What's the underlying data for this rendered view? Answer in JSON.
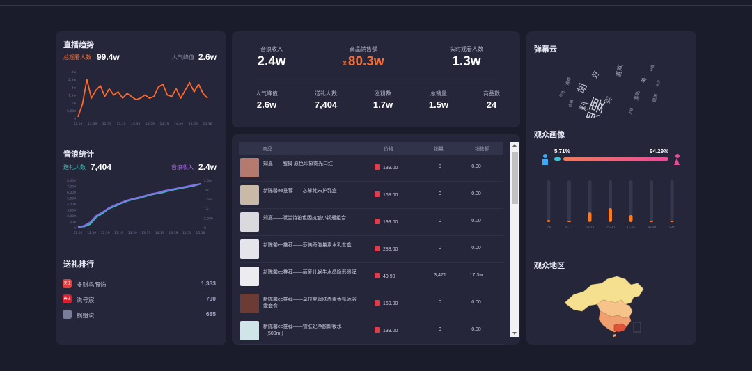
{
  "trend": {
    "title": "直播趋势",
    "total_label": "总观看人数",
    "total_value": "99.4w",
    "peak_label": "人气峰值",
    "peak_value": "2.6w"
  },
  "gift_stats": {
    "title": "音浪统计",
    "gift_people_label": "送礼人数",
    "gift_people_value": "7,404",
    "income_label": "音浪收入",
    "income_value": "2.4w"
  },
  "ranking": {
    "title": "送礼排行",
    "items": [
      {
        "badge": "美注",
        "name": "多财鸟服饰",
        "value": "1,383",
        "color": "#e53b3b"
      },
      {
        "badge": "美注",
        "name": "说号宸",
        "value": "790",
        "color": "#e11b2b"
      },
      {
        "badge": "",
        "name": "锅姐说",
        "value": "685",
        "color": "#7a7d9a"
      }
    ]
  },
  "summary": {
    "top": [
      {
        "label": "音浪收入",
        "value": "2.4w"
      },
      {
        "label": "商品销售额",
        "value": "80.3w",
        "prefix": "¥"
      },
      {
        "label": "实时观看人数",
        "value": "1.3w"
      }
    ],
    "bottom": [
      {
        "label": "人气峰值",
        "value": "2.6w"
      },
      {
        "label": "送礼人数",
        "value": "7,404"
      },
      {
        "label": "涨粉数",
        "value": "1.7w"
      },
      {
        "label": "总销量",
        "value": "1.5w"
      },
      {
        "label": "商品数",
        "value": "24"
      }
    ]
  },
  "table": {
    "headers": [
      "商品",
      "价格",
      "销量",
      "销售额"
    ],
    "rows": [
      {
        "name": "知嘉——醒摸 原色印象雾光口红",
        "price": "139.00",
        "qty": "0",
        "amount": "0.00",
        "thumb": "#b57a6e"
      },
      {
        "name": "新陈馨ee推荐——芯掌梵未护乳盒",
        "price": "168.00",
        "qty": "0",
        "amount": "0.00",
        "thumb": "#c9b9a6"
      },
      {
        "name": "知嘉——賦兰诗铂色因抗皱小钢瓶组合",
        "price": "199.00",
        "qty": "0",
        "amount": "0.00",
        "thumb": "#d9d9de"
      },
      {
        "name": "新陈馨ee推荐——莎美奇能量素水乳套盒",
        "price": "288.00",
        "qty": "0",
        "amount": "0.00",
        "thumb": "#e4e4ea"
      },
      {
        "name": "新陈馨ee推荐——丽爱儿蜗牛水晶隐形眼膜",
        "price": "49.90",
        "qty": "3,471",
        "amount": "17.3w",
        "thumb": "#ececf0"
      },
      {
        "name": "新陈馨ee推荐——莫拉克润肤赤素香氛沐浴露套盒",
        "price": "169.00",
        "qty": "0",
        "amount": "0.00",
        "thumb": "#6b3b34"
      },
      {
        "name": "新陈馨ee推荐——雪肤妃净颜卸妆水（500ml）",
        "price": "139.00",
        "qty": "0",
        "amount": "0.00",
        "thumb": "#cfe5e8"
      }
    ]
  },
  "danmu": {
    "title": "弹幕云"
  },
  "portrait": {
    "title": "观众画像",
    "male_pct": "5.71%",
    "female_pct": "94.29%"
  },
  "region": {
    "title": "观众地区"
  },
  "colors": {
    "accent_orange": "#ff6a2b",
    "accent_blue": "#3fa9f5",
    "accent_pink": "#e94b9a",
    "purple": "#8a6cf0"
  },
  "chart_data": [
    {
      "type": "line",
      "name": "trend",
      "x": [
        "12:02",
        "12:39",
        "12:59",
        "13:19",
        "13:39",
        "13:59",
        "14:19",
        "14:39",
        "14:59",
        "15:16"
      ],
      "ytick_labels": [
        "0",
        "5,000",
        "1w",
        "1.5w",
        "2w",
        "2.5w",
        "3w"
      ],
      "ylim": [
        0,
        30000
      ],
      "series": [
        {
          "values": [
            1000,
            9000,
            25000,
            13000,
            18000,
            21000,
            14000,
            19000,
            15000,
            17000,
            13000,
            16000,
            14000,
            12000,
            13000,
            15000,
            13000,
            14000,
            20000,
            22000,
            15000,
            14000,
            19000,
            13000,
            18000,
            23000,
            17000,
            22000,
            16000,
            13000
          ]
        }
      ]
    },
    {
      "type": "line",
      "name": "gift",
      "x": [
        "12:02",
        "12:39",
        "12:59",
        "13:19",
        "13:39",
        "13:59",
        "14:19",
        "14:39",
        "14:59",
        "15:16"
      ],
      "ytick_labels": [
        "0",
        "1,000",
        "2,000",
        "3,000",
        "4,000",
        "5,000",
        "6,000",
        "7,000",
        "8,000"
      ],
      "ylim": [
        0,
        8000
      ],
      "y2tick_labels": [
        "0",
        "5,000",
        "1w",
        "1.5w",
        "2w",
        "2.5w"
      ],
      "y2lim": [
        0,
        25000
      ],
      "series": [
        {
          "values": [
            100,
            200,
            600,
            1800,
            2400,
            3200,
            3600,
            4100,
            4500,
            4800,
            5000,
            5300,
            5600,
            5800,
            6000,
            6300,
            6500,
            6700,
            6900,
            7100,
            7400
          ]
        },
        {
          "values": [
            100,
            300,
            900,
            2000,
            2600,
            3300,
            3800,
            4200,
            4600,
            4900,
            5100,
            5400,
            5700,
            5900,
            6200,
            6400,
            6600,
            6800,
            7000,
            7200,
            7400
          ],
          "axis": "y2"
        }
      ]
    },
    {
      "type": "bar",
      "name": "age",
      "categories": [
        "<6",
        "6-17",
        "18-24",
        "25-30",
        "31-35",
        "36-40",
        ">40"
      ],
      "values": [
        3,
        2,
        14,
        20,
        10,
        2,
        2
      ],
      "ylim": [
        0,
        60
      ]
    }
  ]
}
